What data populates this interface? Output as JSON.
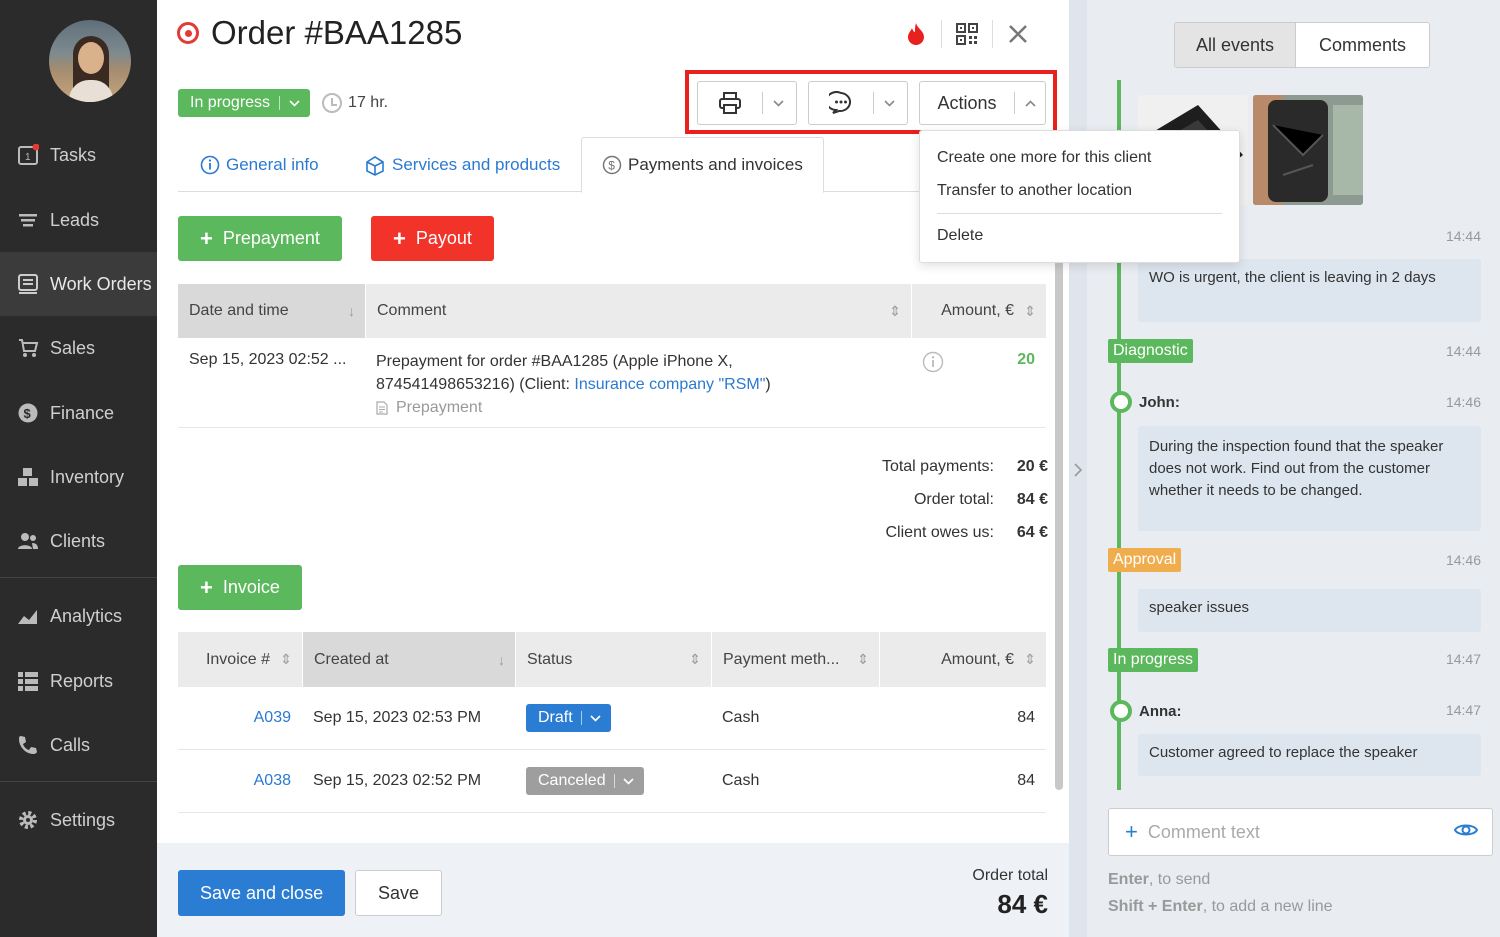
{
  "sidebar": {
    "items": [
      {
        "label": "Tasks",
        "icon": "tasks-icon"
      },
      {
        "label": "Leads",
        "icon": "leads-icon"
      },
      {
        "label": "Work Orders",
        "icon": "work-orders-icon"
      },
      {
        "label": "Sales",
        "icon": "cart-icon"
      },
      {
        "label": "Finance",
        "icon": "dollar-icon"
      },
      {
        "label": "Inventory",
        "icon": "boxes-icon"
      },
      {
        "label": "Clients",
        "icon": "users-icon"
      },
      {
        "label": "Analytics",
        "icon": "chart-icon"
      },
      {
        "label": "Reports",
        "icon": "list-icon"
      },
      {
        "label": "Calls",
        "icon": "phone-icon"
      },
      {
        "label": "Settings",
        "icon": "gear-icon"
      }
    ],
    "active": "Work Orders",
    "tasks_badge_digit": "1"
  },
  "order": {
    "title": "Order #BAA1285",
    "status": "In progress",
    "elapsed": "17 hr.",
    "actions_label": "Actions"
  },
  "tabs": {
    "general": "General info",
    "services": "Services and products",
    "payments": "Payments and invoices"
  },
  "buttons": {
    "prepayment": "Prepayment",
    "payout": "Payout",
    "invoice": "Invoice",
    "save_close": "Save and close",
    "save": "Save"
  },
  "payments_table": {
    "headers": {
      "date": "Date and time",
      "comment": "Comment",
      "amount": "Amount, €"
    },
    "rows": [
      {
        "date": "Sep 15, 2023 02:52 ...",
        "comment_line1": "Prepayment for order #BAA1285 (Apple iPhone X,",
        "comment_line2_prefix": "874541498653216) (Client: ",
        "comment_link": "Insurance company \"RSM\"",
        "comment_line2_suffix": ")",
        "type": "Prepayment",
        "amount": "20"
      }
    ]
  },
  "totals": {
    "total_payments_label": "Total payments:",
    "total_payments": "20 €",
    "order_total_label": "Order total:",
    "order_total": "84 €",
    "client_owes_label": "Client owes us:",
    "client_owes": "64 €"
  },
  "invoices_table": {
    "headers": {
      "num": "Invoice #",
      "created": "Created at",
      "status": "Status",
      "method": "Payment meth...",
      "amount": "Amount, €"
    },
    "rows": [
      {
        "num": "A039",
        "created": "Sep 15, 2023 02:53 PM",
        "status": "Draft",
        "status_color": "#2b7cd3",
        "method": "Cash",
        "amount": "84"
      },
      {
        "num": "A038",
        "created": "Sep 15, 2023 02:52 PM",
        "status": "Canceled",
        "status_color": "#9e9e9e",
        "method": "Cash",
        "amount": "84"
      }
    ]
  },
  "footer": {
    "order_total_label": "Order total",
    "order_total_value": "84 €"
  },
  "actions_menu": {
    "items": [
      "Create one more for this client",
      "Transfer to another location",
      "Delete"
    ]
  },
  "right_panel": {
    "tabs": {
      "events": "All events",
      "comments": "Comments"
    },
    "timeline": [
      {
        "kind": "time",
        "time": "14:44"
      },
      {
        "kind": "message",
        "text": "WO is urgent, the client is leaving in 2 days"
      },
      {
        "kind": "status",
        "label": "Diagnostic",
        "color": "#5cb85c",
        "time": "14:44"
      },
      {
        "kind": "author",
        "name": "John:",
        "time": "14:46"
      },
      {
        "kind": "message",
        "text": "During the inspection found that the speaker does not work. Find out from the customer whether it needs to be changed."
      },
      {
        "kind": "status",
        "label": "Approval",
        "color": "#f0ad4e",
        "time": "14:46"
      },
      {
        "kind": "message",
        "text": "speaker issues"
      },
      {
        "kind": "status",
        "label": "In progress",
        "color": "#5cb85c",
        "time": "14:47"
      },
      {
        "kind": "author",
        "name": "Anna:",
        "time": "14:47"
      },
      {
        "kind": "message",
        "text": "Customer agreed to replace the speaker"
      }
    ],
    "comment_placeholder": "Comment text",
    "hint1_key": "Enter",
    "hint1_text": ", to send",
    "hint2_key": "Shift + Enter",
    "hint2_text": ", to add a new line"
  },
  "colors": {
    "green": "#5cb85c",
    "red": "#f1332a",
    "blue": "#2b7cd3",
    "highlight": "#e8211f",
    "sidebar": "#2b2b2b"
  }
}
